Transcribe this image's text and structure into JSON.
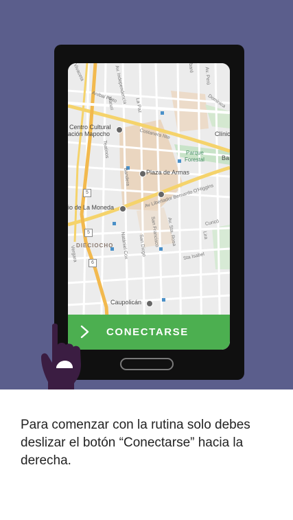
{
  "map": {
    "streets": [
      "Vivaceta",
      "Aníbal Pinto",
      "Av. Independencia",
      "Maruri",
      "La Paz",
      "Tabaré",
      "Av. Perú",
      "Dominica",
      "Costanera Nte",
      "Teatinos",
      "Bandera",
      "Av Libertador Bernardo O'Higgins",
      "Natániel Cox",
      "San Diego",
      "San Francisco",
      "Av. Sta. Rosa",
      "Lira",
      "Curicó",
      "Sta Isabel",
      "Vergara"
    ],
    "places": [
      "Centro Cultural",
      "ación Mapocho",
      "Clínic",
      "Parque",
      "Forestal",
      "Ba",
      "Plaza de Armas",
      "io de La Moneda",
      "Caupolicán"
    ],
    "district": "DIECIOCHO",
    "route_shields": [
      "5",
      "5",
      "6"
    ],
    "edge_letters": [
      "l"
    ]
  },
  "connect_button": {
    "label": "CONECTARSE",
    "arrow_icon": "chevron-right-icon",
    "color": "#4caf50"
  },
  "instruction": "Para comenzar con la rutina solo debes deslizar el botón “Conectarse” hacia la derecha.",
  "colors": {
    "background": "#5b5e8c",
    "phone": "#101010",
    "hand": "#3b1d42"
  }
}
